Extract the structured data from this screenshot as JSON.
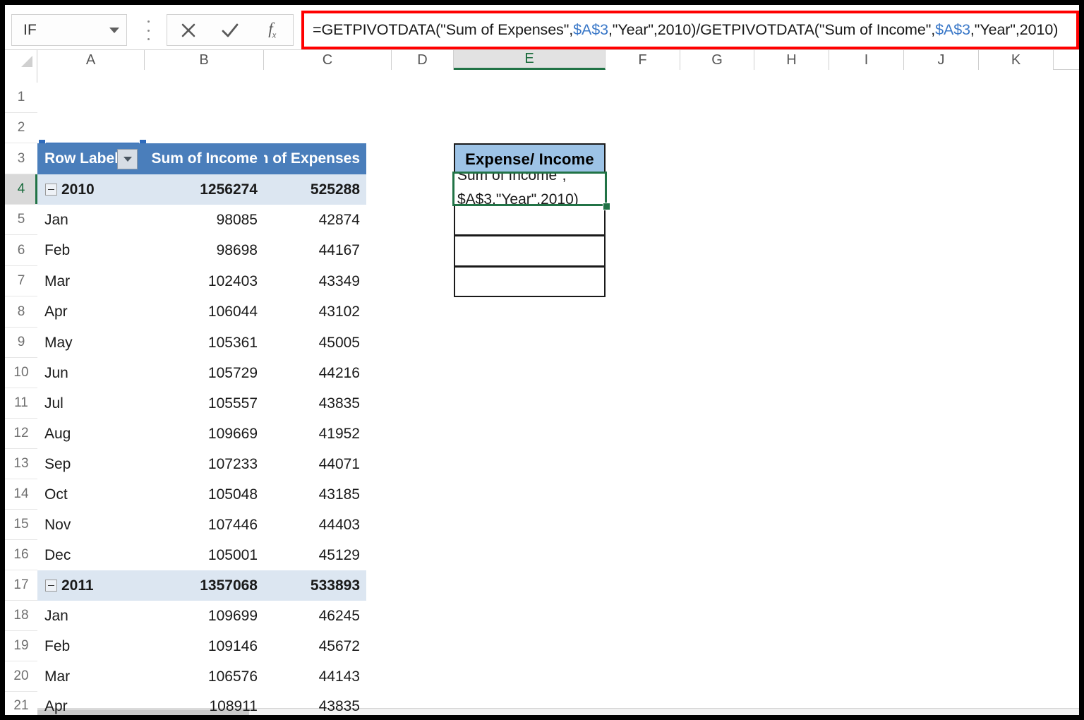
{
  "formula_bar": {
    "name_box_value": "IF",
    "name_box_icon": "chevron-down-icon",
    "kebab_icon": "more-options-icon",
    "cancel_icon": "cancel-x-icon",
    "enter_icon": "enter-check-icon",
    "insert_function_icon": "fx-icon",
    "formula_parts": [
      {
        "text": "=GETPIVOTDATA(\"Sum of Expenses\",",
        "style": "plain"
      },
      {
        "text": "$A$3",
        "style": "ref"
      },
      {
        "text": ",\"Year\",2010)/GETPIVOTDATA(\"Sum of Income\",",
        "style": "plain"
      },
      {
        "text": "$A$3",
        "style": "ref"
      },
      {
        "text": ",\"Year\",2010)",
        "style": "plain"
      }
    ],
    "formula_full": "=GETPIVOTDATA(\"Sum of Expenses\",$A$3,\"Year\",2010)/GETPIVOTDATA(\"Sum of Income\",$A$3,\"Year\",2010)",
    "highlight_color": "#ff0000"
  },
  "grid": {
    "columns": [
      "A",
      "B",
      "C",
      "D",
      "E",
      "F",
      "G",
      "H",
      "I",
      "J",
      "K"
    ],
    "active_column": "E",
    "active_row": "4",
    "row_numbers": [
      "1",
      "2",
      "3",
      "4",
      "5",
      "6",
      "7",
      "8",
      "9",
      "10",
      "11",
      "12",
      "13",
      "14",
      "15",
      "16",
      "17",
      "18",
      "19",
      "20",
      "21"
    ]
  },
  "pivot_table": {
    "header": {
      "row_labels": "Row Labels",
      "filter_icon": "filter-dropdown-icon",
      "sum_of_income": "Sum of Income",
      "sum_of_expenses": "Sum of Expenses"
    },
    "header_fill": "#4a7ebb",
    "band_fill": "#dce6f1",
    "rows": [
      {
        "row": "4",
        "label": "2010",
        "group": true,
        "income": "1256274",
        "expenses": "525288"
      },
      {
        "row": "5",
        "label": "Jan",
        "group": false,
        "income": "98085",
        "expenses": "42874"
      },
      {
        "row": "6",
        "label": "Feb",
        "group": false,
        "income": "98698",
        "expenses": "44167"
      },
      {
        "row": "7",
        "label": "Mar",
        "group": false,
        "income": "102403",
        "expenses": "43349"
      },
      {
        "row": "8",
        "label": "Apr",
        "group": false,
        "income": "106044",
        "expenses": "43102"
      },
      {
        "row": "9",
        "label": "May",
        "group": false,
        "income": "105361",
        "expenses": "45005"
      },
      {
        "row": "10",
        "label": "Jun",
        "group": false,
        "income": "105729",
        "expenses": "44216"
      },
      {
        "row": "11",
        "label": "Jul",
        "group": false,
        "income": "105557",
        "expenses": "43835"
      },
      {
        "row": "12",
        "label": "Aug",
        "group": false,
        "income": "109669",
        "expenses": "41952"
      },
      {
        "row": "13",
        "label": "Sep",
        "group": false,
        "income": "107233",
        "expenses": "44071"
      },
      {
        "row": "14",
        "label": "Oct",
        "group": false,
        "income": "105048",
        "expenses": "43185"
      },
      {
        "row": "15",
        "label": "Nov",
        "group": false,
        "income": "107446",
        "expenses": "44403"
      },
      {
        "row": "16",
        "label": "Dec",
        "group": false,
        "income": "105001",
        "expenses": "45129"
      },
      {
        "row": "17",
        "label": "2011",
        "group": true,
        "income": "1357068",
        "expenses": "533893"
      },
      {
        "row": "18",
        "label": "Jan",
        "group": false,
        "income": "109699",
        "expenses": "46245"
      },
      {
        "row": "19",
        "label": "Feb",
        "group": false,
        "income": "109146",
        "expenses": "45672"
      },
      {
        "row": "20",
        "label": "Mar",
        "group": false,
        "income": "106576",
        "expenses": "44143"
      },
      {
        "row": "21",
        "label": "Apr",
        "group": false,
        "income": "108911",
        "expenses": "43835"
      }
    ]
  },
  "side_table": {
    "header_label": "Expense/ Income",
    "header_fill": "#9dc3e6",
    "editing_cell": "E4",
    "editing_line_1": "Sum of Income\",",
    "editing_line_2": "$A$3,\"Year\",2010)",
    "empty_cells": [
      "E5",
      "E6",
      "E7"
    ],
    "selection_color": "#217346"
  }
}
